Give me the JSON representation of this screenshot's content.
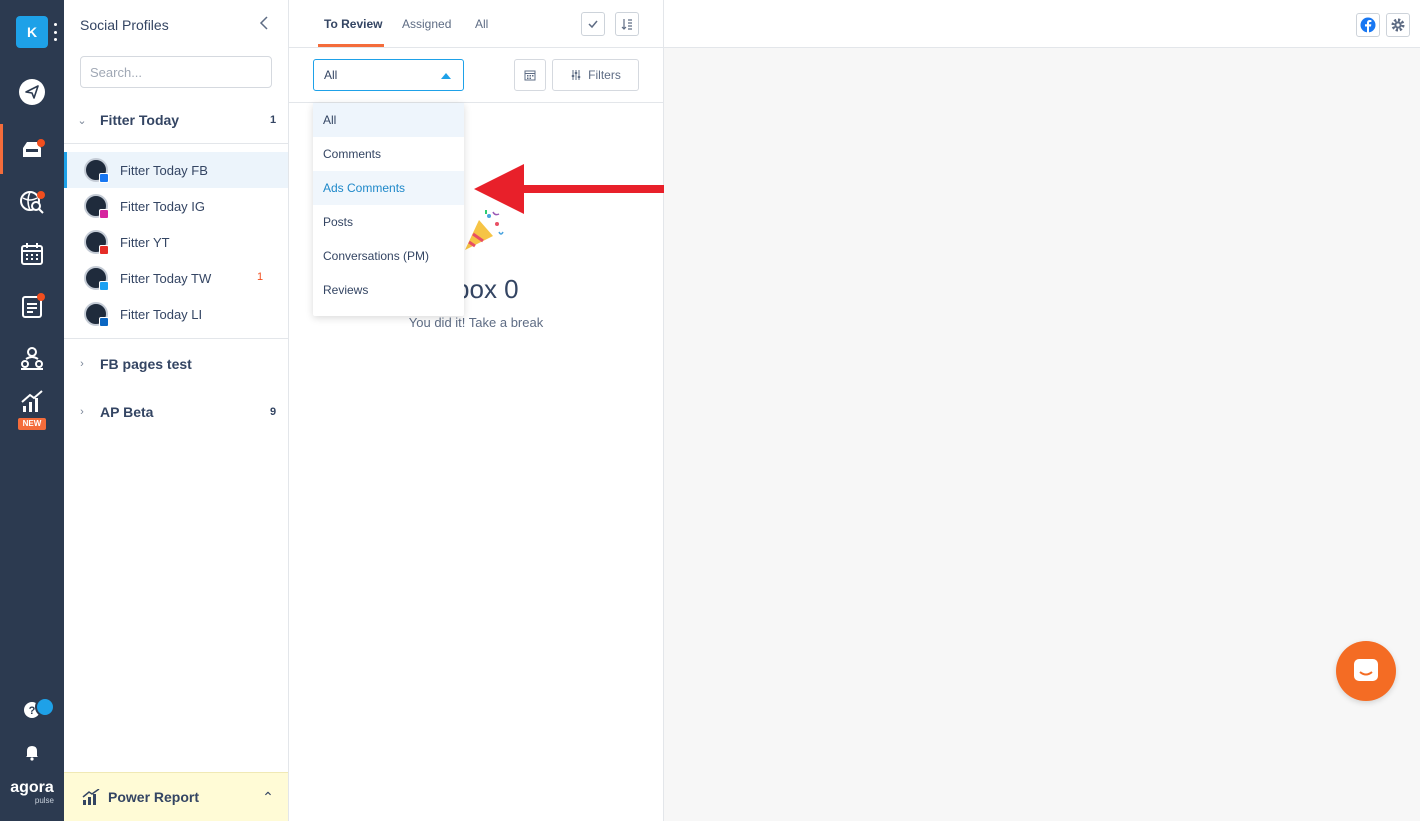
{
  "rail": {
    "workspace_initial": "K",
    "new_badge": "NEW",
    "logo_word": "agora",
    "logo_sub": "pulse"
  },
  "profiles": {
    "title": "Social Profiles",
    "search_placeholder": "Search...",
    "groups": [
      {
        "name": "Fitter Today",
        "count": "1",
        "expanded": true
      },
      {
        "name": "FB pages test",
        "count": "",
        "expanded": false
      },
      {
        "name": "AP Beta",
        "count": "9",
        "expanded": false
      }
    ],
    "items": [
      {
        "name": "Fitter Today FB",
        "network": "facebook",
        "count": ""
      },
      {
        "name": "Fitter Today IG",
        "network": "instagram",
        "count": ""
      },
      {
        "name": "Fitter YT",
        "network": "youtube",
        "count": ""
      },
      {
        "name": "Fitter Today TW",
        "network": "twitter",
        "count": "1"
      },
      {
        "name": "Fitter Today LI",
        "network": "linkedin",
        "count": ""
      }
    ],
    "power_report": "Power Report"
  },
  "inbox": {
    "tabs": [
      "To Review",
      "Assigned",
      "All"
    ],
    "active_tab": "To Review",
    "select_value": "All",
    "filters_label": "Filters",
    "empty_title": "Inbox 0",
    "empty_subtitle": "You did it! Take a break",
    "dropdown": [
      "All",
      "Comments",
      "Ads Comments",
      "Posts",
      "Conversations (PM)",
      "Reviews"
    ],
    "dropdown_selected": "All",
    "dropdown_hover": "Ads Comments"
  },
  "colors": {
    "rail_bg": "#2c3a50",
    "accent_orange": "#f46c3b",
    "accent_blue": "#1ea1e8",
    "arrow_red": "#e8202a"
  }
}
